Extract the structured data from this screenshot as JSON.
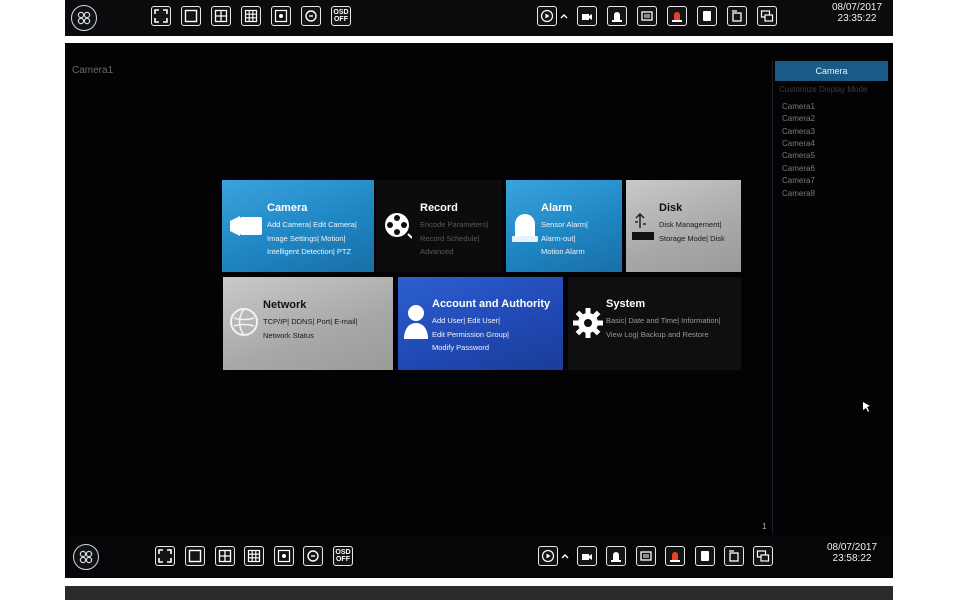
{
  "top_bar": {
    "date": "08/07/2017",
    "time": "23:35:22",
    "osd_label_1": "OSD",
    "osd_label_2": "OFF"
  },
  "main": {
    "camera_label": "Camera1",
    "sidebar": {
      "header": "Camera",
      "subheader": "Customize Display Mode",
      "cameras": [
        "Camera1",
        "Camera2",
        "Camera3",
        "Camera4",
        "Camera5",
        "Camera6",
        "Camera7",
        "Camera8"
      ]
    },
    "page_number": "1",
    "tiles": [
      {
        "title": "Camera",
        "lines": [
          "Add Camera| Edit Camera|",
          "Image Settings| Motion|",
          "Intelligent Detection| PTZ"
        ]
      },
      {
        "title": "Record",
        "lines": [
          "Encode Parameters|",
          "Record Schedule|",
          "Advanced"
        ]
      },
      {
        "title": "Alarm",
        "lines": [
          "Sensor Alarm|",
          "Alarm-out|",
          "Motion Alarm"
        ]
      },
      {
        "title": "Disk",
        "lines": [
          "Disk Management|",
          "Storage Mode| Disk"
        ]
      },
      {
        "title": "Network",
        "lines": [
          "TCP/IP| DDNS| Port| E-mail|",
          "Network Status"
        ]
      },
      {
        "title": "Account and Authority",
        "lines": [
          "Add User| Edit User|",
          "Edit Permission Group|",
          "Modify Password"
        ]
      },
      {
        "title": "System",
        "lines": [
          "Basic| Date and Time| Information|",
          "View Log| Backup and Restore"
        ]
      }
    ]
  },
  "bottom_bar": {
    "date": "08/07/2017",
    "time": "23:58:22",
    "osd_label_1": "OSD",
    "osd_label_2": "OFF"
  },
  "colors": {
    "tile_blue": "#2a8fcf",
    "tile_gray": "#b0b0b0",
    "tile_dark_blue": "#2450c0",
    "sidebar_header": "#1a5a86"
  }
}
